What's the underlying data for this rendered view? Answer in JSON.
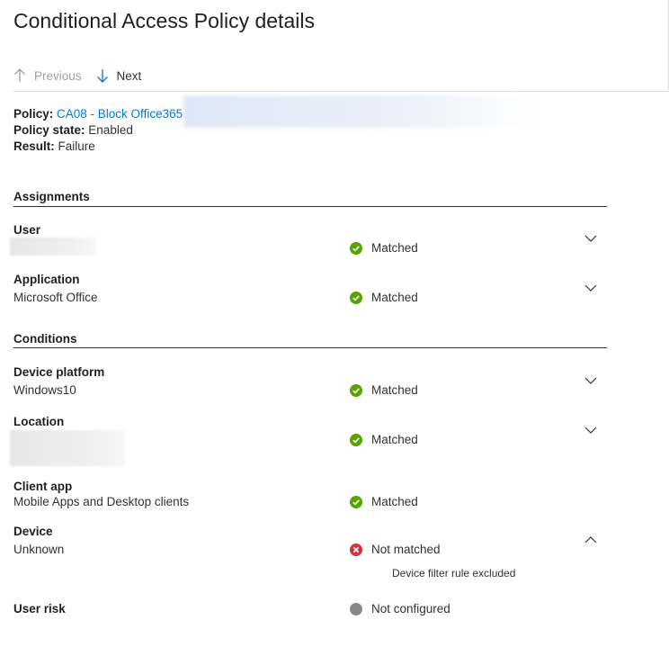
{
  "title": "Conditional Access Policy details",
  "toolbar": {
    "previous_label": "Previous",
    "next_label": "Next"
  },
  "policy": {
    "policy_label": "Policy:",
    "policy_name": "CA08 - Block Office365",
    "state_label": "Policy state:",
    "state_value": "Enabled",
    "result_label": "Result:",
    "result_value": "Failure"
  },
  "assignments": {
    "heading": "Assignments",
    "user": {
      "label": "User",
      "status": "Matched"
    },
    "application": {
      "label": "Application",
      "value": "Microsoft Office",
      "status": "Matched"
    }
  },
  "conditions": {
    "heading": "Conditions",
    "device_platform": {
      "label": "Device platform",
      "value": "Windows10",
      "status": "Matched"
    },
    "location": {
      "label": "Location",
      "status": "Matched"
    },
    "client_app": {
      "label": "Client app",
      "value": "Mobile Apps and Desktop clients",
      "status": "Matched"
    },
    "device": {
      "label": "Device",
      "value": "Unknown",
      "status": "Not matched",
      "note": "Device filter rule excluded"
    },
    "user_risk": {
      "label": "User risk",
      "status": "Not configured"
    }
  },
  "colors": {
    "matched": "#57a300",
    "not_matched": "#d13438",
    "not_configured": "#8a8886",
    "link": "#0078d4"
  }
}
